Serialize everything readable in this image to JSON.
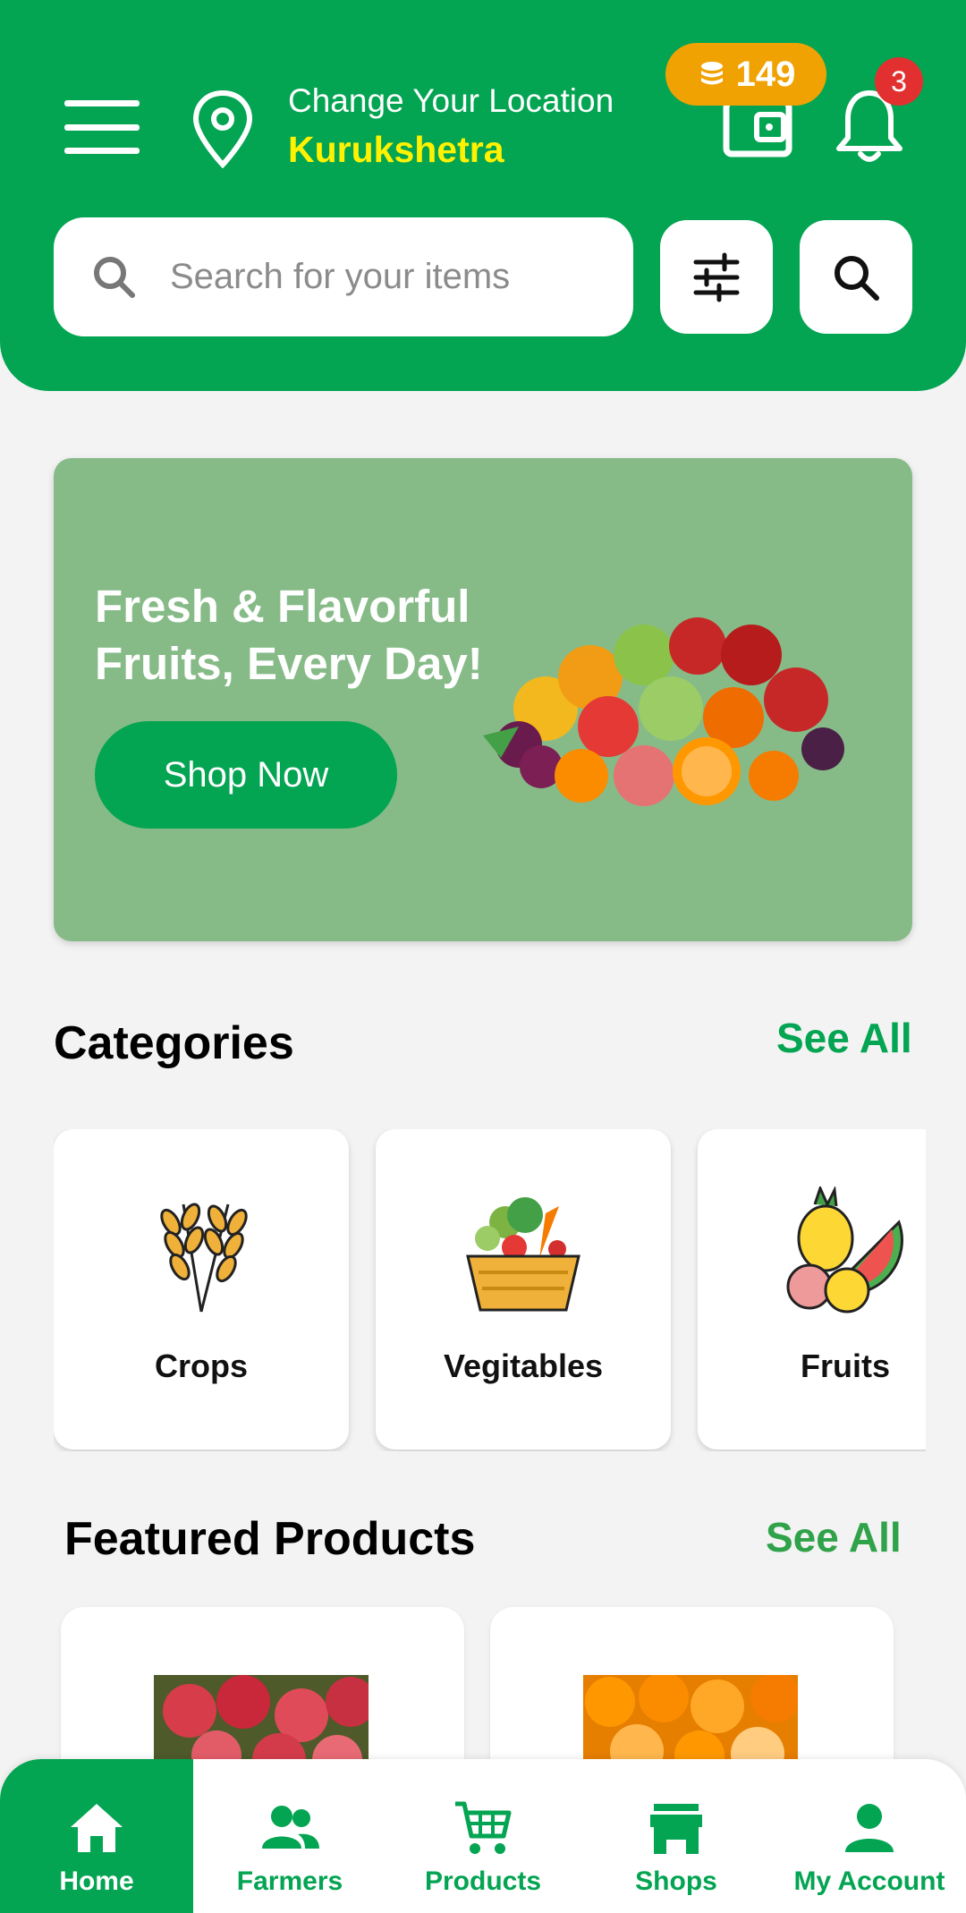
{
  "header": {
    "location_label": "Change Your Location",
    "location_city": "Kurukshetra",
    "coins": "149",
    "notification_count": "3"
  },
  "search": {
    "placeholder": "Search for your items"
  },
  "banner": {
    "title": "Fresh & Flavorful Fruits, Every Day!",
    "button_label": "Shop Now"
  },
  "categories": {
    "title": "Categories",
    "see_all": "See All",
    "items": [
      {
        "label": "Crops",
        "icon": "wheat-icon"
      },
      {
        "label": "Vegitables",
        "icon": "vegetable-basket-icon"
      },
      {
        "label": "Fruits",
        "icon": "fruits-icon"
      }
    ]
  },
  "featured": {
    "title": "Featured Products",
    "see_all": "See All",
    "items": [
      {
        "image": "apples-image"
      },
      {
        "image": "oranges-image"
      }
    ]
  },
  "bottom_nav": {
    "items": [
      {
        "label": "Home",
        "icon": "home-icon",
        "active": true
      },
      {
        "label": "Farmers",
        "icon": "farmers-icon",
        "active": false
      },
      {
        "label": "Products",
        "icon": "cart-icon",
        "active": false
      },
      {
        "label": "Shops",
        "icon": "shop-icon",
        "active": false
      },
      {
        "label": "My Account",
        "icon": "account-icon",
        "active": false
      }
    ]
  },
  "colors": {
    "brand_green": "#03a452",
    "banner_green": "#86bb88",
    "city_yellow": "#fff200",
    "coin_orange": "#f0a202",
    "badge_red": "#e23030",
    "see_all_green": "#03a452",
    "see_all_green_alt": "#2fa24a"
  }
}
